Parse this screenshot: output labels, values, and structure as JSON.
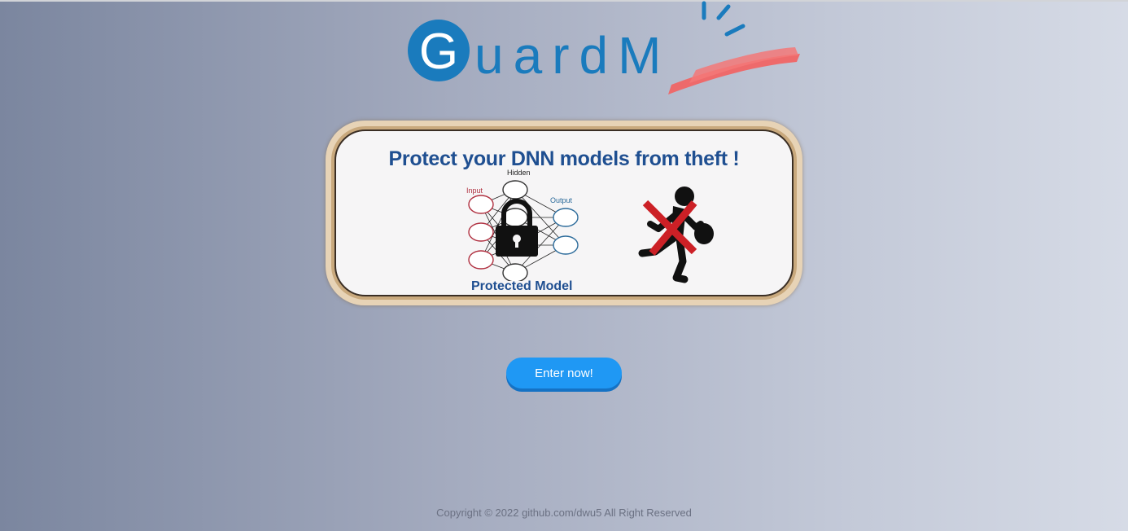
{
  "logo": {
    "text": "GuardM",
    "letter_g": "G",
    "rest": "uardM",
    "colors": {
      "primary": "#1a7bbd",
      "accent": "#f06060"
    }
  },
  "banner": {
    "title": "Protect your DNN models from theft !",
    "net_labels": {
      "input": "Input",
      "hidden": "Hidden",
      "output": "Output"
    },
    "caption": "Protected Model",
    "icons": [
      "neural-network-icon",
      "padlock-icon",
      "thief-icon",
      "cross-mark-icon"
    ]
  },
  "actions": {
    "enter_label": "Enter now!"
  },
  "footer": {
    "copyright": "Copyright © 2022 github.com/dwu5 All Right Reserved"
  },
  "colors": {
    "button": "#1f98f4",
    "title": "#1f4f91"
  }
}
